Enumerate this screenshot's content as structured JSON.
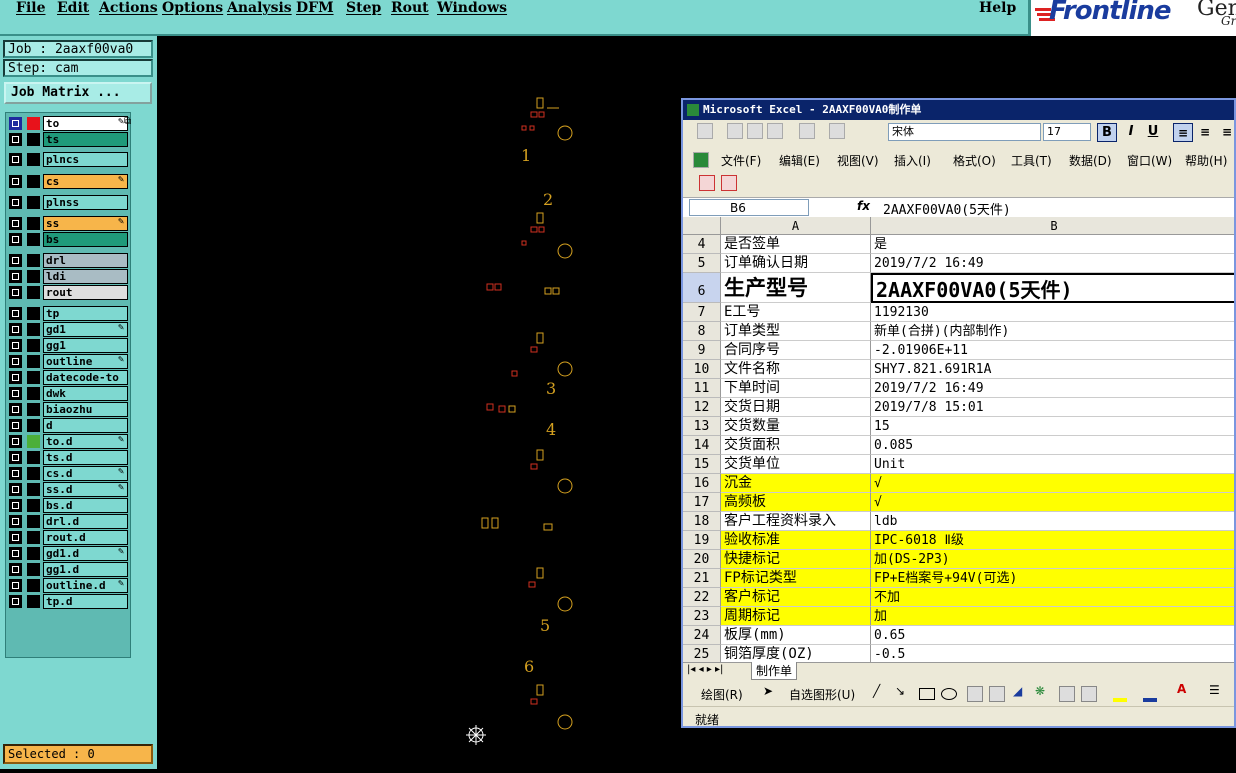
{
  "menubar": {
    "items": [
      "File",
      "Edit",
      "Actions",
      "Options",
      "Analysis",
      "DFM",
      "Step",
      "Rout",
      "Windows"
    ],
    "help": "Help"
  },
  "logo": {
    "brand": "Frontline",
    "partial1": "Gen",
    "partial2": "Gr"
  },
  "left_panel": {
    "job": "Job : 2aaxf00va0",
    "step": "Step: cam",
    "job_matrix_button": "Job Matrix ...",
    "layers": [
      {
        "name": "to",
        "bg": "#ffffff",
        "swatch": "#e8121b",
        "edit": "✎⧉",
        "box": "#1e2a9e"
      },
      {
        "name": "ts",
        "bg": "#1f9a7a",
        "swatch": "#000000",
        "edit": ""
      },
      {
        "name": "plncs",
        "bg": "#7ed8d0",
        "swatch": "#000000",
        "edit": ""
      },
      {
        "name": "cs",
        "bg": "#f7b54a",
        "swatch": "#000000",
        "edit": "✎"
      },
      {
        "name": "plnss",
        "bg": "#7ed8d0",
        "swatch": "#000000",
        "edit": ""
      },
      {
        "name": "ss",
        "bg": "#f7b54a",
        "swatch": "#000000",
        "edit": "✎"
      },
      {
        "name": "bs",
        "bg": "#1f9a7a",
        "swatch": "#000000",
        "edit": ""
      },
      {
        "name": "drl",
        "bg": "#a9bcc4",
        "swatch": "#000000",
        "edit": ""
      },
      {
        "name": "ldi",
        "bg": "#a9bcc4",
        "swatch": "#000000",
        "edit": ""
      },
      {
        "name": "rout",
        "bg": "#dedede",
        "swatch": "#000000",
        "edit": ""
      },
      {
        "name": "tp",
        "bg": "#7ed8d0",
        "swatch": "#000000",
        "edit": ""
      },
      {
        "name": "gd1",
        "bg": "#7ed8d0",
        "swatch": "#000000",
        "edit": "✎"
      },
      {
        "name": "gg1",
        "bg": "#7ed8d0",
        "swatch": "#000000",
        "edit": ""
      },
      {
        "name": "outline",
        "bg": "#7ed8d0",
        "swatch": "#000000",
        "edit": "✎"
      },
      {
        "name": "datecode-to",
        "bg": "#7ed8d0",
        "swatch": "#000000",
        "edit": ""
      },
      {
        "name": "dwk",
        "bg": "#7ed8d0",
        "swatch": "#000000",
        "edit": ""
      },
      {
        "name": "biaozhu",
        "bg": "#7ed8d0",
        "swatch": "#000000",
        "edit": ""
      },
      {
        "name": "d",
        "bg": "#7ed8d0",
        "swatch": "#000000",
        "edit": ""
      },
      {
        "name": "to.d",
        "bg": "#7ed8d0",
        "swatch": "#4caf3a",
        "edit": "✎"
      },
      {
        "name": "ts.d",
        "bg": "#7ed8d0",
        "swatch": "#000000",
        "edit": ""
      },
      {
        "name": "cs.d",
        "bg": "#7ed8d0",
        "swatch": "#000000",
        "edit": "✎"
      },
      {
        "name": "ss.d",
        "bg": "#7ed8d0",
        "swatch": "#000000",
        "edit": "✎"
      },
      {
        "name": "bs.d",
        "bg": "#7ed8d0",
        "swatch": "#000000",
        "edit": ""
      },
      {
        "name": "drl.d",
        "bg": "#7ed8d0",
        "swatch": "#000000",
        "edit": ""
      },
      {
        "name": "rout.d",
        "bg": "#7ed8d0",
        "swatch": "#000000",
        "edit": ""
      },
      {
        "name": "gd1.d",
        "bg": "#7ed8d0",
        "swatch": "#000000",
        "edit": "✎"
      },
      {
        "name": "gg1.d",
        "bg": "#7ed8d0",
        "swatch": "#000000",
        "edit": ""
      },
      {
        "name": "outline.d",
        "bg": "#7ed8d0",
        "swatch": "#000000",
        "edit": "✎"
      },
      {
        "name": "tp.d",
        "bg": "#7ed8d0",
        "swatch": "#000000",
        "edit": ""
      }
    ],
    "selected": "Selected : 0"
  },
  "pcb": {
    "numbers": [
      "1",
      "2",
      "3",
      "4",
      "5",
      "6"
    ]
  },
  "excel": {
    "title": "Microsoft Excel - 2AAXF00VA0制作单",
    "font_name": "宋体",
    "font_size": "17",
    "bold": "B",
    "italic": "I",
    "underline": "U",
    "menu": [
      "文件(F)",
      "编辑(E)",
      "视图(V)",
      "插入(I)",
      "格式(O)",
      "工具(T)",
      "数据(D)",
      "窗口(W)",
      "帮助(H)"
    ],
    "name_box": "B6",
    "fx": "fx",
    "formula_value": "2AAXF00VA0(5天件)",
    "col_a": "A",
    "col_b": "B",
    "rows": [
      {
        "n": "4",
        "a": "是否签单",
        "b": "是",
        "hl": false
      },
      {
        "n": "5",
        "a": "订单确认日期",
        "b": "2019/7/2 16:49",
        "hl": false
      },
      {
        "n": "6",
        "a": "生产型号",
        "b": "2AAXF00VA0(5天件)",
        "hl": false,
        "big": true
      },
      {
        "n": "7",
        "a": "E工号",
        "b": "1192130",
        "hl": false
      },
      {
        "n": "8",
        "a": "订单类型",
        "b": "新单(合拼)(内部制作)",
        "hl": false
      },
      {
        "n": "9",
        "a": "合同序号",
        "b": "-2.01906E+11",
        "hl": false
      },
      {
        "n": "10",
        "a": "文件名称",
        "b": "SHY7.821.691R1A",
        "hl": false
      },
      {
        "n": "11",
        "a": "下单时间",
        "b": "2019/7/2 16:49",
        "hl": false
      },
      {
        "n": "12",
        "a": "交货日期",
        "b": "2019/7/8 15:01",
        "hl": false
      },
      {
        "n": "13",
        "a": "交货数量",
        "b": "15",
        "hl": false
      },
      {
        "n": "14",
        "a": "交货面积",
        "b": "0.085",
        "hl": false
      },
      {
        "n": "15",
        "a": "交货单位",
        "b": "Unit",
        "hl": false
      },
      {
        "n": "16",
        "a": "沉金",
        "b": "√",
        "hl": true
      },
      {
        "n": "17",
        "a": "高频板",
        "b": "√",
        "hl": true
      },
      {
        "n": "18",
        "a": "客户工程资料录入",
        "b": "ldb",
        "hl": false
      },
      {
        "n": "19",
        "a": "验收标准",
        "b": "IPC-6018 Ⅱ级",
        "hl": true,
        "hlB": true
      },
      {
        "n": "20",
        "a": "快捷标记",
        "b": "加(DS-2P3)",
        "hl": true,
        "hlB": true
      },
      {
        "n": "21",
        "a": "FP标记类型",
        "b": "FP+E档案号+94V(可选)",
        "hl": true,
        "hlB": true
      },
      {
        "n": "22",
        "a": "客户标记",
        "b": "不加",
        "hl": true,
        "hlB": true
      },
      {
        "n": "23",
        "a": "周期标记",
        "b": "加",
        "hl": true,
        "hlB": true
      },
      {
        "n": "24",
        "a": "板厚(mm)",
        "b": "0.65",
        "hl": false
      },
      {
        "n": "25",
        "a": "铜箔厚度(OZ)",
        "b": "-0.5",
        "hl": false
      }
    ],
    "sheet_tab": "制作单",
    "draw_label": "绘图(R)",
    "autoshape_label": "自选图形(U)",
    "status": "就绪"
  },
  "colors": {
    "panel": "#7ed8d0",
    "highlight": "#ffff00",
    "title_bar": "#0a246a",
    "accent_orange": "#f7b54a"
  }
}
